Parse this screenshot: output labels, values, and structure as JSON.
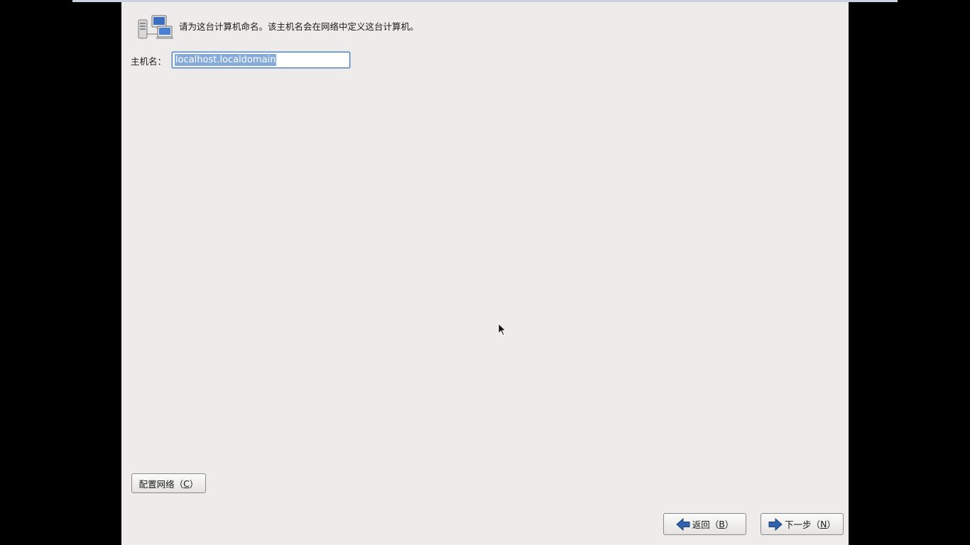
{
  "header": {
    "icon": "network-computers-icon",
    "text": "请为这台计算机命名。该主机名会在网络中定义这台计算机。"
  },
  "hostname": {
    "label": "主机名：",
    "value": "localhost.localdomain"
  },
  "buttons": {
    "configure_network": {
      "prefix": "配置网络（",
      "mnemonic": "C",
      "suffix": "）"
    },
    "back": {
      "prefix": "返回（",
      "mnemonic": "B",
      "suffix": "）",
      "icon": "arrow-left-icon"
    },
    "next": {
      "prefix": "下一步（",
      "mnemonic": "N",
      "suffix": "）",
      "icon": "arrow-right-icon"
    }
  },
  "colors": {
    "panel_background": "#edeceb",
    "selection": "#86abd9",
    "arrow_blue": "#2f63b0"
  }
}
